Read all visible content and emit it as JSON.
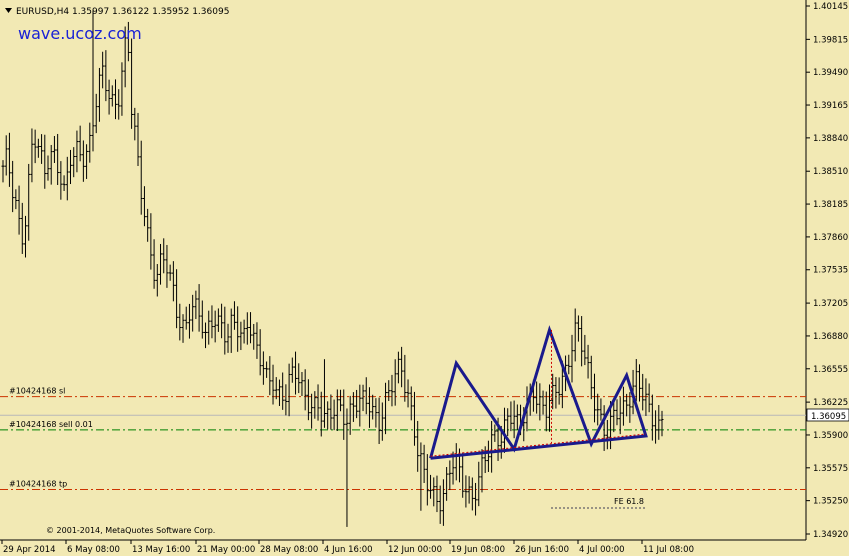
{
  "header": {
    "symbol_line": "EURUSD,H4  1.35997 1.36122 1.35952 1.36095"
  },
  "watermark": "wave.ucoz.com",
  "copyright": "© 2001-2014, MetaQuotes Software Corp.",
  "chart_data": {
    "type": "candlestick-bar",
    "title": "EURUSD,H4",
    "ohlc_current": {
      "open": 1.35997,
      "high": 1.36122,
      "low": 1.35952,
      "close": 1.36095
    },
    "ylim": [
      1.348,
      1.4015
    ],
    "y_ticks": [
      "1.40145",
      "1.39815",
      "1.39490",
      "1.39165",
      "1.38840",
      "1.38510",
      "1.38185",
      "1.37860",
      "1.37535",
      "1.37205",
      "1.36880",
      "1.36555",
      "1.36225",
      "1.35900",
      "1.35575",
      "1.35250",
      "1.34920"
    ],
    "x_ticks": [
      "29 Apr 2014",
      "6 May 08:00",
      "13 May 16:00",
      "21 May 00:00",
      "28 May 08:00",
      "4 Jun 16:00",
      "12 Jun 00:00",
      "19 Jun 08:00",
      "26 Jun 16:00",
      "4 Jul 00:00",
      "11 Jul 08:00"
    ],
    "current_price": {
      "label": "1.36095",
      "value": 1.36095
    },
    "levels": [
      {
        "label": "#10424168 sl",
        "value": 1.3628,
        "color": "#cc3300",
        "style": "dashdot"
      },
      {
        "label": "#10424168 sell 0.01",
        "value": 1.3595,
        "color": "#008000",
        "style": "dashdot"
      },
      {
        "label": "#10424168 tp",
        "value": 1.3536,
        "color": "#cc3300",
        "style": "dashdot"
      }
    ],
    "fibo_label": "FE 61.8",
    "series_close": [
      1.385,
      1.3862,
      1.384,
      1.3825,
      1.38,
      1.3785,
      1.383,
      1.387,
      1.388,
      1.3865,
      1.385,
      1.387,
      1.3875,
      1.386,
      1.3842,
      1.382,
      1.3858,
      1.3866,
      1.3875,
      1.387,
      1.3872,
      1.388,
      1.3905,
      1.393,
      1.3945,
      1.3935,
      1.3925,
      1.392,
      1.393,
      1.396,
      1.3985,
      1.391,
      1.388,
      1.384,
      1.382,
      1.379,
      1.376,
      1.3745,
      1.3755,
      1.376,
      1.375,
      1.3735,
      1.3715,
      1.3705,
      1.3695,
      1.371,
      1.3715,
      1.3705,
      1.37,
      1.369,
      1.3705,
      1.3712,
      1.3702,
      1.369,
      1.368,
      1.3695,
      1.37,
      1.3698,
      1.369,
      1.3705,
      1.3695,
      1.367,
      1.366,
      1.3655,
      1.364,
      1.365,
      1.364,
      1.363,
      1.3625,
      1.364,
      1.3645,
      1.365,
      1.364,
      1.363,
      1.3625,
      1.362,
      1.3615,
      1.3605,
      1.36,
      1.361,
      1.362,
      1.3625,
      1.3615,
      1.3605,
      1.361,
      1.3615,
      1.362,
      1.3625,
      1.363,
      1.362,
      1.361,
      1.36,
      1.3615,
      1.3625,
      1.364,
      1.3655,
      1.3665,
      1.3645,
      1.3625,
      1.36,
      1.357,
      1.3555,
      1.3545,
      1.354,
      1.3535,
      1.353,
      1.3525,
      1.354,
      1.3555,
      1.356,
      1.3555,
      1.3545,
      1.354,
      1.353,
      1.3535,
      1.3545,
      1.356,
      1.357,
      1.3585,
      1.3595,
      1.359,
      1.36,
      1.361,
      1.3605,
      1.3595,
      1.36,
      1.3615,
      1.363,
      1.364,
      1.3625,
      1.3615,
      1.361,
      1.362,
      1.363,
      1.364,
      1.365,
      1.366,
      1.3675,
      1.369,
      1.3685,
      1.367,
      1.3655,
      1.364,
      1.3625,
      1.361,
      1.3595,
      1.359,
      1.36,
      1.361,
      1.3615,
      1.362,
      1.363,
      1.364,
      1.3645,
      1.363,
      1.362,
      1.361,
      1.3605,
      1.36,
      1.3609
    ],
    "pattern_points": [
      {
        "i": 133,
        "p": 1.3567
      },
      {
        "i": 141,
        "p": 1.3661
      },
      {
        "i": 159,
        "p": 1.3576
      },
      {
        "i": 170,
        "p": 1.3694
      },
      {
        "i": 183,
        "p": 1.3581
      },
      {
        "i": 194,
        "p": 1.3649
      },
      {
        "i": 200,
        "p": 1.3589
      },
      {
        "i": 133,
        "p": 1.3567
      }
    ]
  }
}
